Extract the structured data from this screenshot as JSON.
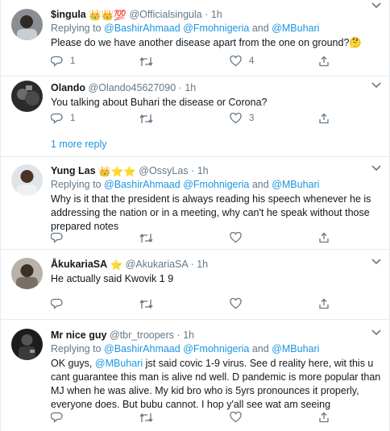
{
  "reply_prefix": "Replying to",
  "and_word": "and",
  "tweets": [
    {
      "name": "$ingula",
      "badge": "👑👑💯",
      "handle": "@Officialsingula",
      "dot": "·",
      "time": "1h",
      "reply_to": [
        "@BashirAhmaad",
        "@Fmohnigeria",
        "@MBuhari"
      ],
      "text": "Please do we have another disease apart from the one on ground?🤔",
      "reply_count": "1",
      "retweet_count": "",
      "like_count": "4"
    },
    {
      "name": "Olando",
      "handle": "@Olando45627090",
      "dot": "·",
      "time": "1h",
      "text": "You talking about Buhari the disease or Corona?",
      "reply_count": "1",
      "retweet_count": "",
      "like_count": "3"
    },
    {
      "name": "Yung Las",
      "badge": "👑⭐⭐",
      "handle": "@OssyLas",
      "dot": "·",
      "time": "1h",
      "reply_to": [
        "@BashirAhmaad",
        "@Fmohnigeria",
        "@MBuhari"
      ],
      "text": "Why is it that the president is always reading his speech whenever he is addressing the nation or in a meeting, why can't he speak without those prepared notes",
      "reply_count": "",
      "retweet_count": "",
      "like_count": ""
    },
    {
      "name": "ÅkukariaSA",
      "badge": "⭐",
      "handle": "@AkukariaSA",
      "dot": "·",
      "time": "1h",
      "text": "He actually said Kwovik 1 9",
      "reply_count": "",
      "retweet_count": "",
      "like_count": ""
    },
    {
      "name": "Mr nice guy",
      "handle": "@tbr_troopers",
      "dot": "·",
      "time": "1h",
      "reply_to": [
        "@BashirAhmaad",
        "@Fmohnigeria",
        "@MBuhari"
      ],
      "text_prefix": "OK guys, ",
      "text_mention": "@MBuhari",
      "text": " jst said covic 1-9 virus. See d reality here, wit this u cant guarantee this man is alive nd well. D pandemic is more popular than MJ when he was alive. My kid bro who is 5yrs pronounces it properly, everyone does. But bubu cannot. I hop y'all see wat am seeing",
      "reply_count": "",
      "retweet_count": "",
      "like_count": ""
    }
  ],
  "more_replies": "1 more reply",
  "colors": {
    "link": "#1b95e0",
    "muted": "#657786",
    "border": "#e6ecf0",
    "text": "#14171a"
  },
  "icons": [
    "reply-icon",
    "retweet-icon",
    "like-icon",
    "share-icon",
    "caret-down-icon"
  ]
}
